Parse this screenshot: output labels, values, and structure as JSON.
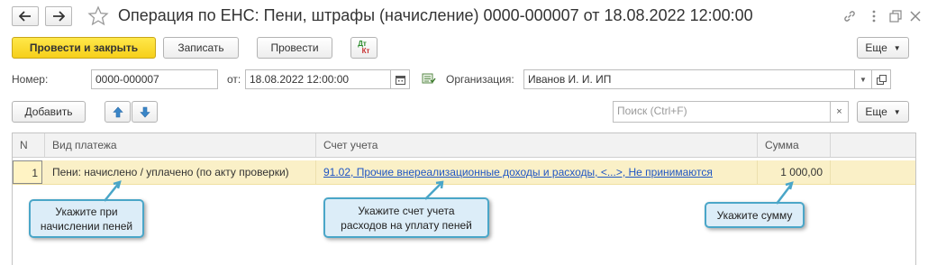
{
  "window": {
    "title": "Операция по ЕНС: Пени, штрафы (начисление) 0000-000007 от 18.08.2022 12:00:00"
  },
  "toolbar": {
    "post_close_label": "Провести и закрыть",
    "save_label": "Записать",
    "post_label": "Провести",
    "dt_kt_top": "Дт",
    "dt_kt_bottom": "Кт",
    "more_label": "Еще"
  },
  "form": {
    "number_label": "Номер:",
    "number_value": "0000-000007",
    "date_label": "от:",
    "date_value": "18.08.2022 12:00:00",
    "org_label": "Организация:",
    "org_value": "Иванов И. И. ИП"
  },
  "table_toolbar": {
    "add_label": "Добавить",
    "search_placeholder": "Поиск (Ctrl+F)",
    "more_label": "Еще"
  },
  "table": {
    "columns": [
      "N",
      "Вид платежа",
      "Счет учета",
      "Сумма"
    ],
    "rows": [
      {
        "n": "1",
        "payment_type": "Пени: начислено / уплачено (по акту проверки)",
        "account": "91.02, Прочие внереализационные доходы и расходы, <...>, Не принимаются",
        "amount": "1 000,00"
      }
    ]
  },
  "callouts": {
    "penalty_line1": "Укажите при",
    "penalty_line2": "начислении пеней",
    "account_line1": "Укажите счет учета",
    "account_line2": "расходов на уплату пеней",
    "amount": "Укажите сумму"
  },
  "colors": {
    "primary_button": "#f6cf1a",
    "selected_row": "#faf0c7",
    "link": "#1f56c4",
    "callout_border": "#4aa6c8",
    "callout_fill": "#dcedf8"
  },
  "icons": [
    "back-arrow-icon",
    "forward-arrow-icon",
    "star-icon",
    "link-icon",
    "kebab-menu-icon",
    "restore-window-icon",
    "close-icon",
    "calendar-icon",
    "document-status-icon",
    "dropdown-icon",
    "open-form-icon",
    "arrow-up-icon",
    "arrow-down-icon",
    "clear-icon"
  ]
}
